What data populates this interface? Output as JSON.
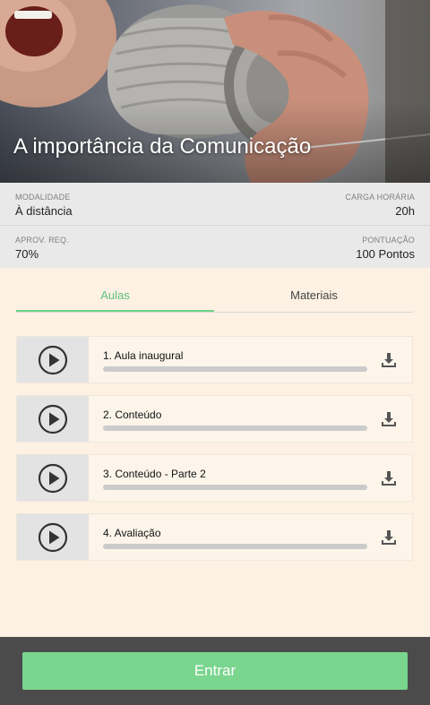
{
  "hero": {
    "title": "A importância da Comunicação"
  },
  "info": {
    "modalidade_label": "MODALIDADE",
    "modalidade_value": "À distância",
    "carga_label": "CARGA HORÁRIA",
    "carga_value": "20h",
    "aprov_label": "APROV. REQ.",
    "aprov_value": "70%",
    "pontuacao_label": "PONTUAÇÃO",
    "pontuacao_value": "100 Pontos"
  },
  "tabs": [
    {
      "label": "Aulas",
      "active": true
    },
    {
      "label": "Materiais",
      "active": false
    }
  ],
  "lessons": [
    {
      "title": "1. Aula inaugural",
      "progress": 0
    },
    {
      "title": "2. Conteúdo",
      "progress": 0
    },
    {
      "title": "3. Conteúdo - Parte 2",
      "progress": 0
    },
    {
      "title": "4. Avaliação",
      "progress": 0
    }
  ],
  "footer": {
    "button_label": "Entrar"
  },
  "colors": {
    "accent": "#6dd38a",
    "background": "#fdf1e3",
    "info_background": "#e9e9e9",
    "footer": "#4b4b4b",
    "button": "#7ad58e"
  },
  "icons": {
    "play": "play-circle-icon",
    "download": "download-icon"
  }
}
